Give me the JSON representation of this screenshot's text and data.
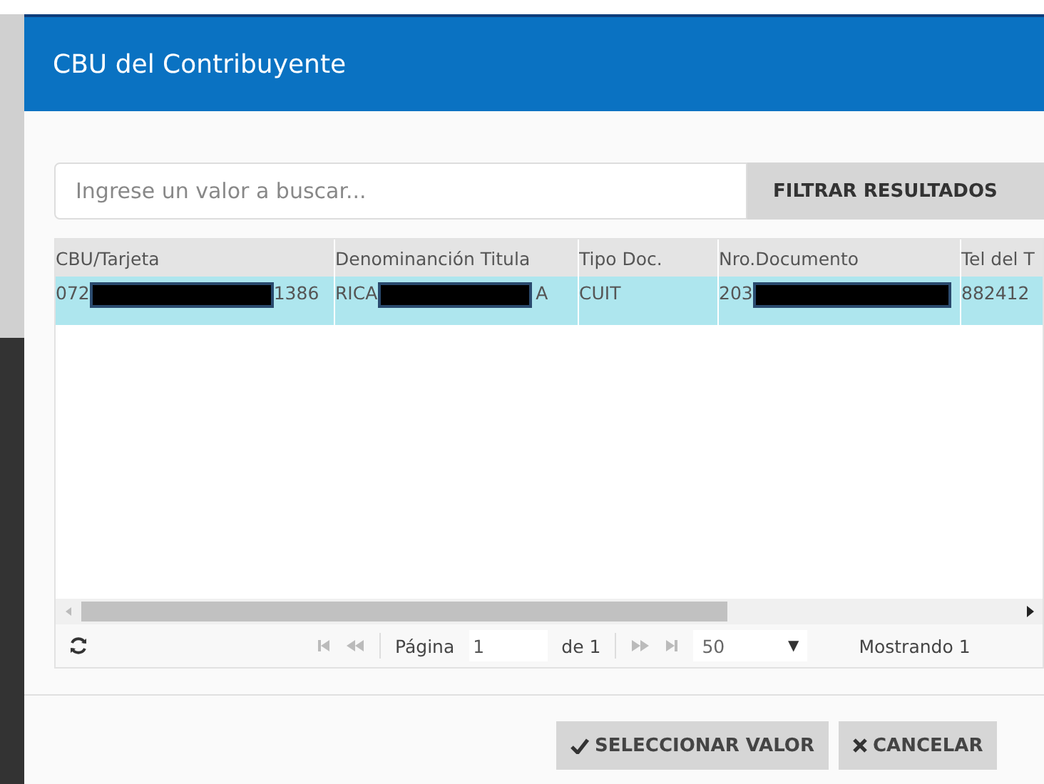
{
  "dialog": {
    "title": "CBU del Contribuyente"
  },
  "search": {
    "placeholder": "Ingrese un valor a buscar...",
    "button": "FILTRAR RESULTADOS"
  },
  "table": {
    "columns": [
      "CBU/Tarjeta",
      "Denominanción Titula",
      "Tipo Doc.",
      "Nro.Documento",
      "Tel del T"
    ],
    "rows": [
      {
        "selected": true,
        "cells": [
          {
            "prefix": "072",
            "suffix": "1386",
            "redacted": true
          },
          {
            "prefix": "RICA",
            "suffix": "A",
            "redacted": true
          },
          {
            "prefix": "CUIT",
            "redacted": false
          },
          {
            "prefix": "203",
            "redacted": true
          },
          {
            "prefix": "882412",
            "redacted": false
          }
        ]
      }
    ]
  },
  "pager": {
    "page_label": "Página",
    "page": "1",
    "of_label": "de 1",
    "page_size": "50",
    "size_arrow": "▼",
    "summary": "Mostrando 1"
  },
  "buttons": [
    {
      "kind": "check",
      "label": "SELECCIONAR VALOR"
    },
    {
      "kind": "cross",
      "label": "CANCELAR"
    }
  ]
}
